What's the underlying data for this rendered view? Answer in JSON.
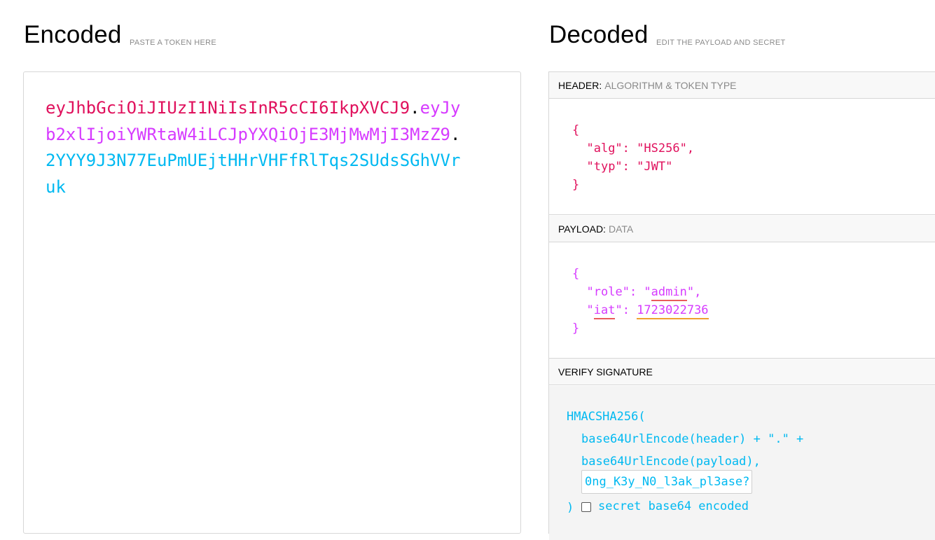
{
  "encoded": {
    "title": "Encoded",
    "subtitle": "PASTE A TOKEN HERE",
    "token": {
      "header": "eyJhbGciOiJIUzI1NiIsInR5cCI6IkpXVCJ9",
      "dot1": ".",
      "payload": "eyJyb2xlIjoiYWRtaW4iLCJpYXQiOjE3MjMwMjI3MzZ9",
      "dot2": ".",
      "signature": "2YYY9J3N77EuPmUEjtHHrVHFfRlTqs2SUdsSGhVVruk"
    }
  },
  "decoded": {
    "title": "Decoded",
    "subtitle": "EDIT THE PAYLOAD AND SECRET",
    "header_section": {
      "label": "HEADER:",
      "desc": "ALGORITHM & TOKEN TYPE",
      "open": "{",
      "line1_key": "\"alg\"",
      "line1_val": "\"HS256\"",
      "line2_key": "\"typ\"",
      "line2_val": "\"JWT\"",
      "close": "}"
    },
    "payload_section": {
      "label": "PAYLOAD:",
      "desc": "DATA",
      "open": "{",
      "q": "\"",
      "line1_key": "role",
      "line1_val": "admin",
      "line2_key": "iat",
      "line2_val": "1723022736",
      "close": "}"
    },
    "verify_section": {
      "label": "VERIFY SIGNATURE",
      "fn": "HMACSHA256(",
      "line1": "base64UrlEncode(header) + \".\" +",
      "line2": "base64UrlEncode(payload),",
      "secret_value": "0ng_K3y_N0_l3ak_pl3ase?",
      "close_paren": ")",
      "checkbox_label": "secret base64 encoded"
    }
  },
  "colors": {
    "header": "#e0105c",
    "payload": "#d63aff",
    "signature": "#00b9f1"
  }
}
